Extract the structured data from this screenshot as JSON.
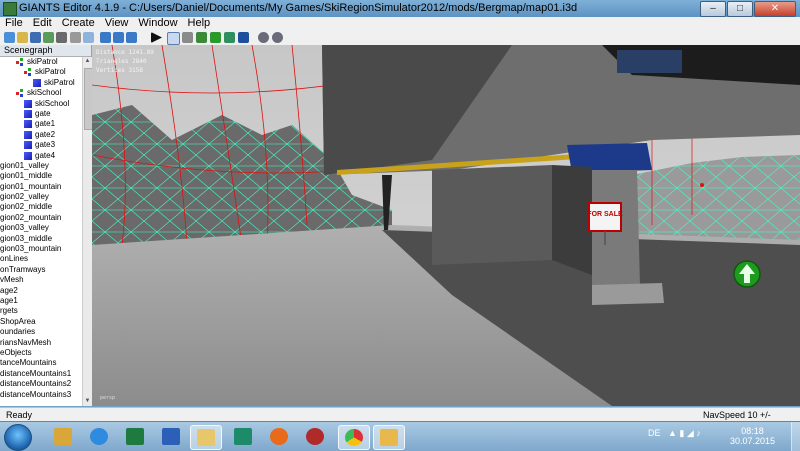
{
  "window": {
    "title": "GIANTS Editor 4.1.9 - C:/Users/Daniel/Documents/My Games/SkiRegionSimulator2012/mods/Bergmap/map01.i3d"
  },
  "menu": [
    "File",
    "Edit",
    "Create",
    "View",
    "Window",
    "Help"
  ],
  "window_buttons": {
    "minimize": "–",
    "maximize": "□",
    "close": "✕"
  },
  "scenegraph": {
    "header": "Scenegraph",
    "items": [
      {
        "label": "skiPatrol",
        "icon": "transform-group-icon",
        "indent": 2
      },
      {
        "label": "skiPatrol",
        "icon": "transform-group-icon",
        "indent": 3
      },
      {
        "label": "skiPatrol",
        "icon": "shape-cube-icon",
        "indent": 4
      },
      {
        "label": "skiSchool",
        "icon": "transform-group-icon",
        "indent": 2
      },
      {
        "label": "skiSchool",
        "icon": "shape-cube-icon",
        "indent": 3
      },
      {
        "label": "gate",
        "icon": "shape-cube-icon",
        "indent": 3
      },
      {
        "label": "gate1",
        "icon": "shape-cube-icon",
        "indent": 3
      },
      {
        "label": "gate2",
        "icon": "shape-cube-icon",
        "indent": 3
      },
      {
        "label": "gate3",
        "icon": "shape-cube-icon",
        "indent": 3
      },
      {
        "label": "gate4",
        "icon": "shape-cube-icon",
        "indent": 3
      },
      {
        "label": "gion01_valley",
        "icon": "",
        "indent": 0
      },
      {
        "label": "gion01_middle",
        "icon": "",
        "indent": 0
      },
      {
        "label": "gion01_mountain",
        "icon": "",
        "indent": 0
      },
      {
        "label": "gion02_valley",
        "icon": "",
        "indent": 0
      },
      {
        "label": "gion02_middle",
        "icon": "",
        "indent": 0
      },
      {
        "label": "gion02_mountain",
        "icon": "",
        "indent": 0
      },
      {
        "label": "gion03_valley",
        "icon": "",
        "indent": 0
      },
      {
        "label": "gion03_middle",
        "icon": "",
        "indent": 0
      },
      {
        "label": "gion03_mountain",
        "icon": "",
        "indent": 0
      },
      {
        "label": "onLines",
        "icon": "",
        "indent": 0
      },
      {
        "label": "onTramways",
        "icon": "",
        "indent": 0
      },
      {
        "label": "vMesh",
        "icon": "",
        "indent": 0
      },
      {
        "label": "age2",
        "icon": "",
        "indent": 0
      },
      {
        "label": "age1",
        "icon": "",
        "indent": 0
      },
      {
        "label": "rgets",
        "icon": "",
        "indent": 0
      },
      {
        "label": "ShopArea",
        "icon": "",
        "indent": 0
      },
      {
        "label": "oundaries",
        "icon": "",
        "indent": 0
      },
      {
        "label": "riansNavMesh",
        "icon": "",
        "indent": 0
      },
      {
        "label": "eObjects",
        "icon": "",
        "indent": 0
      },
      {
        "label": "tanceMountains",
        "icon": "",
        "indent": 0
      },
      {
        "label": "distanceMountains1",
        "icon": "",
        "indent": 0
      },
      {
        "label": "distanceMountains2",
        "icon": "",
        "indent": 0
      },
      {
        "label": "distanceMountains3",
        "icon": "",
        "indent": 0
      }
    ]
  },
  "viewport": {
    "stats": [
      "Distance 1241.89",
      "Triangles 2840",
      "Vertices 3158"
    ],
    "sign_text": "FOR SALE",
    "corner_label": "persp"
  },
  "status": {
    "left": "Ready",
    "right": "NavSpeed 10 +/-"
  },
  "taskbar": {
    "language": "DE",
    "time": "08:18",
    "date": "30.07.2015",
    "apps": [
      "windows-explorer-icon",
      "internet-explorer-icon",
      "excel-icon",
      "word-icon",
      "file-explorer-icon",
      "publisher-icon",
      "firefox-icon",
      "game-icon",
      "chrome-icon",
      "giants-editor-icon"
    ]
  },
  "colors": {
    "wireframe": "#3dffc8",
    "spline": "#e01010",
    "accent": "#2a8a2a"
  }
}
